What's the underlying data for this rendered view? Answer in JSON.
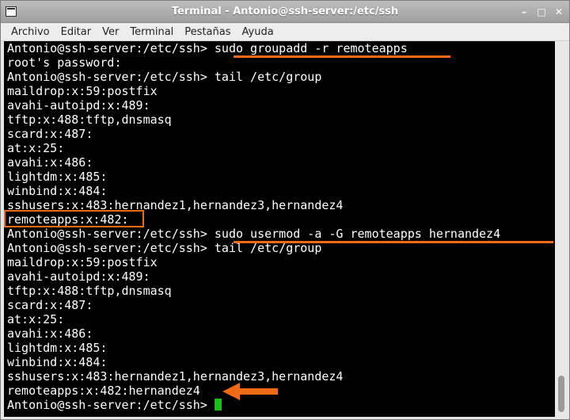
{
  "window": {
    "title": "Terminal - Antonio@ssh-server:/etc/ssh",
    "controls": [
      "–",
      "□",
      "✕"
    ]
  },
  "menu": [
    "Archivo",
    "Editar",
    "Ver",
    "Terminal",
    "Pestañas",
    "Ayuda"
  ],
  "terminal": {
    "lines": [
      "Antonio@ssh-server:/etc/ssh> sudo groupadd -r remoteapps",
      "root's password:",
      "Antonio@ssh-server:/etc/ssh> tail /etc/group",
      "maildrop:x:59:postfix",
      "avahi-autoipd:x:489:",
      "tftp:x:488:tftp,dnsmasq",
      "scard:x:487:",
      "at:x:25:",
      "avahi:x:486:",
      "lightdm:x:485:",
      "winbind:x:484:",
      "sshusers:x:483:hernandez1,hernandez3,hernandez4",
      "remoteapps:x:482:",
      "Antonio@ssh-server:/etc/ssh> sudo usermod -a -G remoteapps hernandez4",
      "Antonio@ssh-server:/etc/ssh> tail /etc/group",
      "maildrop:x:59:postfix",
      "avahi-autoipd:x:489:",
      "tftp:x:488:tftp,dnsmasq",
      "scard:x:487:",
      "at:x:25:",
      "avahi:x:486:",
      "lightdm:x:485:",
      "winbind:x:484:",
      "sshusers:x:483:hernandez1,hernandez3,hernandez4",
      "remoteapps:x:482:hernandez4",
      "Antonio@ssh-server:/etc/ssh> "
    ]
  },
  "colors": {
    "highlight": "#ee6a16",
    "cursor": "#11c511",
    "terminal_bg": "#000000",
    "terminal_fg": "#ffffff"
  }
}
